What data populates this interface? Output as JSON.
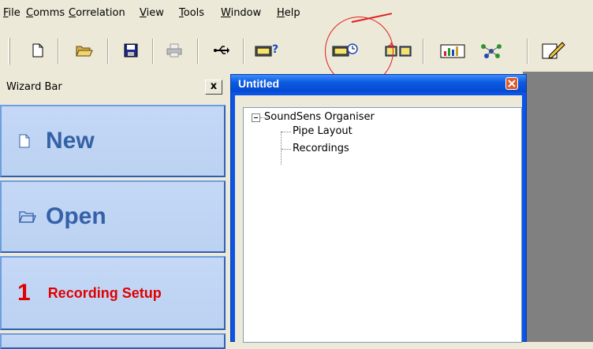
{
  "menu": {
    "items": [
      {
        "id": "file",
        "label": "File"
      },
      {
        "id": "comms",
        "label": "Comms"
      },
      {
        "id": "correlation",
        "label": "Correlation"
      },
      {
        "id": "view",
        "label": "View"
      },
      {
        "id": "tools",
        "label": "Tools"
      },
      {
        "id": "window",
        "label": "Window"
      },
      {
        "id": "help",
        "label": "Help"
      }
    ]
  },
  "toolbar": {
    "icons": [
      "new-document-icon",
      "open-folder-icon",
      "save-disk-icon",
      "print-icon",
      "usb-connect-icon",
      "logger-query-icon",
      "logger-schedule-icon",
      "logger-download-icon",
      "correlation-chart-icon",
      "network-map-icon",
      "edit-pencil-icon"
    ]
  },
  "wizard_bar": {
    "title": "Wizard Bar",
    "close_label": "x",
    "buttons": [
      {
        "label": "New"
      },
      {
        "label": "Open"
      },
      {
        "number": "1",
        "label": "Recording Setup"
      }
    ]
  },
  "child_window": {
    "title": "Untitled",
    "tree": {
      "root": "SoundSens Organiser",
      "children": [
        "Pipe Layout",
        "Recordings"
      ]
    }
  },
  "colors": {
    "accent_blue": "#3461a8",
    "step_red": "#e00000",
    "annotation_red": "#e02020",
    "titlebar_blue": "#0a54e6"
  }
}
